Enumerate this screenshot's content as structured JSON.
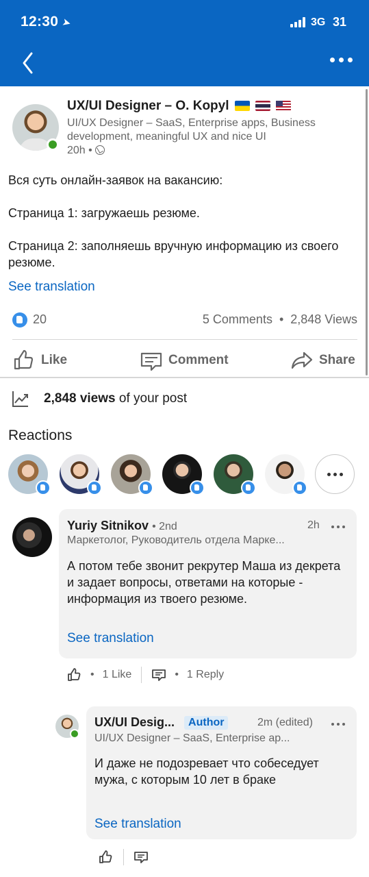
{
  "status_bar": {
    "time": "12:30",
    "network": "3G",
    "battery": "31"
  },
  "nav": {
    "back_icon": "chevron-left-icon",
    "more_icon": "more-horizontal-icon"
  },
  "post": {
    "author_name": "UX/UI Designer – O. Kopyl",
    "headline": "UI/UX Designer – SaaS, Enterprise apps, Business development, meaningful UX and nice UI",
    "time": "20h",
    "visibility_icon": "globe-icon",
    "paragraphs": [
      "Вся суть онлайн-заявок на вакансию:",
      "Страница 1: загружаешь резюме.",
      "Страница 2: заполняешь вручную информацию из своего резюме."
    ],
    "see_translation": "See translation",
    "reactions_count": "20",
    "comments_count": "5 Comments",
    "views_count": "2,848 Views",
    "actions": {
      "like": "Like",
      "comment": "Comment",
      "share": "Share"
    }
  },
  "analytics": {
    "views_bold": "2,848 views",
    "views_rest": "of your post"
  },
  "reactions": {
    "title": "Reactions",
    "count_shown": 6
  },
  "comments": [
    {
      "name": "Yuriy Sitnikov",
      "degree": "2nd",
      "time": "2h",
      "subtitle": "Маркетолог, Руководитель отдела Марке...",
      "text": "А потом тебе звонит рекрутер Маша из декрета и задает вопросы, ответами на которые - информация из твоего резюме.",
      "see_translation": "See translation",
      "likes": "1 Like",
      "replies": "1 Reply"
    }
  ],
  "reply": {
    "name": "UX/UI Desig...",
    "tag": "Author",
    "time": "2m (edited)",
    "subtitle": "UI/UX Designer – SaaS, Enterprise ap...",
    "text": "И даже не подозревает что собеседует мужа, с которым 10 лет в браке",
    "see_translation": "See translation"
  },
  "colors": {
    "brand": "#0a66c2",
    "link": "#0a66c2",
    "online": "#3a9d23",
    "like_badge": "#378fe9"
  }
}
